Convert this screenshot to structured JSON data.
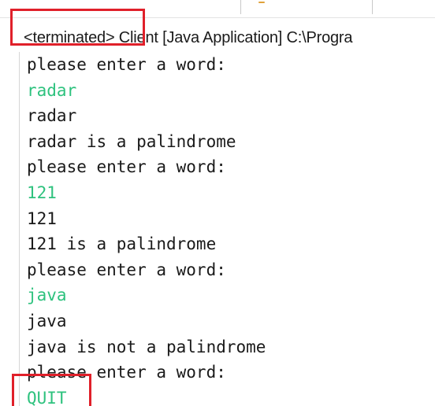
{
  "console": {
    "status": "<terminated> Client [Java Application] C:\\Progra",
    "lines": [
      {
        "text": "please enter a word:",
        "type": "out"
      },
      {
        "text": "radar",
        "type": "in"
      },
      {
        "text": "radar",
        "type": "out"
      },
      {
        "text": "radar is a palindrome",
        "type": "out"
      },
      {
        "text": "please enter a word:",
        "type": "out"
      },
      {
        "text": "121",
        "type": "in"
      },
      {
        "text": "121",
        "type": "out"
      },
      {
        "text": "121 is a palindrome",
        "type": "out"
      },
      {
        "text": "please enter a word:",
        "type": "out"
      },
      {
        "text": "java",
        "type": "in"
      },
      {
        "text": "java",
        "type": "out"
      },
      {
        "text": "java is not a palindrome",
        "type": "out"
      },
      {
        "text": "please enter a word:",
        "type": "out"
      },
      {
        "text": "QUIT",
        "type": "in"
      }
    ]
  },
  "colors": {
    "output_text": "#1a1a1a",
    "user_input_text": "#2ec27e",
    "highlight_box": "#e0202a"
  }
}
